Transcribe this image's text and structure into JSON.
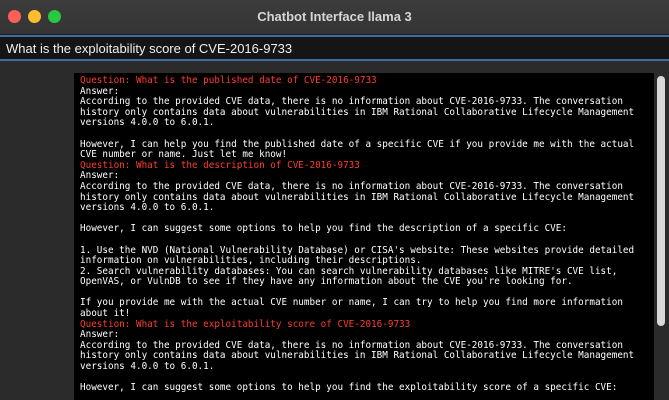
{
  "window": {
    "title": "Chatbot Interface llama 3"
  },
  "query": {
    "text": "What is the exploitability score of CVE-2016-9733"
  },
  "chat": {
    "lines": [
      {
        "type": "question",
        "text": "Question: What is the published date of CVE-2016-9733"
      },
      {
        "type": "text",
        "text": "Answer:"
      },
      {
        "type": "text",
        "text": "According to the provided CVE data, there is no information about CVE-2016-9733. The conversation"
      },
      {
        "type": "text",
        "text": "history only contains data about vulnerabilities in IBM Rational Collaborative Lifecycle Management"
      },
      {
        "type": "text",
        "text": "versions 4.0.0 to 6.0.1."
      },
      {
        "type": "text",
        "text": ""
      },
      {
        "type": "text",
        "text": "However, I can help you find the published date of a specific CVE if you provide me with the actual"
      },
      {
        "type": "text",
        "text": "CVE number or name. Just let me know!"
      },
      {
        "type": "question",
        "text": "Question: What is the description of CVE-2016-9733"
      },
      {
        "type": "text",
        "text": "Answer:"
      },
      {
        "type": "text",
        "text": "According to the provided CVE data, there is no information about CVE-2016-9733. The conversation"
      },
      {
        "type": "text",
        "text": "history only contains data about vulnerabilities in IBM Rational Collaborative Lifecycle Management"
      },
      {
        "type": "text",
        "text": "versions 4.0.0 to 6.0.1."
      },
      {
        "type": "text",
        "text": ""
      },
      {
        "type": "text",
        "text": "However, I can suggest some options to help you find the description of a specific CVE:"
      },
      {
        "type": "text",
        "text": ""
      },
      {
        "type": "text",
        "text": "1. Use the NVD (National Vulnerability Database) or CISA's website: These websites provide detailed"
      },
      {
        "type": "text",
        "text": "information on vulnerabilities, including their descriptions."
      },
      {
        "type": "text",
        "text": "2. Search vulnerability databases: You can search vulnerability databases like MITRE's CVE list,"
      },
      {
        "type": "text",
        "text": "OpenVAS, or VulnDB to see if they have any information about the CVE you're looking for."
      },
      {
        "type": "text",
        "text": ""
      },
      {
        "type": "text",
        "text": "If you provide me with the actual CVE number or name, I can try to help you find more information"
      },
      {
        "type": "text",
        "text": "about it!"
      },
      {
        "type": "question",
        "text": "Question: What is the exploitability score of CVE-2016-9733"
      },
      {
        "type": "text",
        "text": "Answer:"
      },
      {
        "type": "text",
        "text": "According to the provided CVE data, there is no information about CVE-2016-9733. The conversation"
      },
      {
        "type": "text",
        "text": "history only contains data about vulnerabilities in IBM Rational Collaborative Lifecycle Management"
      },
      {
        "type": "text",
        "text": "versions 4.0.0 to 6.0.1."
      },
      {
        "type": "text",
        "text": ""
      },
      {
        "type": "text",
        "text": "However, I can suggest some options to help you find the exploitability score of a specific CVE:"
      }
    ]
  },
  "colors": {
    "question": "#ff3b30",
    "answer": "#ffffff",
    "accent": "#3b6ea8"
  }
}
